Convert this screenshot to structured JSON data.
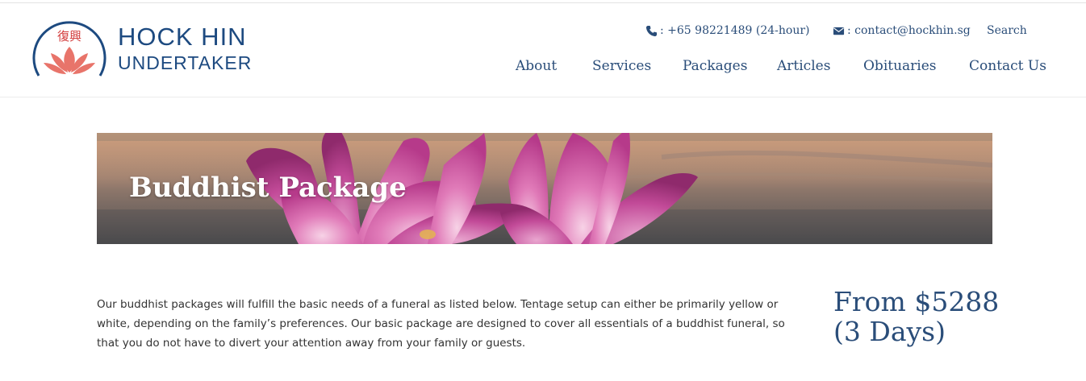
{
  "brand": {
    "chinese_mark": "復興",
    "name_line1": "HOCK HIN",
    "name_line2": "UNDERTAKER",
    "primary_color": "#1d4a80",
    "lotus_color": "#e8746a"
  },
  "contact_bar": {
    "phone_icon": "phone-icon",
    "phone": ": +65 98221489 (24-hour)",
    "email_icon": "envelope-icon",
    "email": ": contact@hockhin.sg",
    "search_label": "Search"
  },
  "nav": {
    "items": [
      "About",
      "Services",
      "Packages",
      "Articles",
      "Obituaries",
      "Contact Us"
    ]
  },
  "banner": {
    "title": "Buddhist Package",
    "image": "pink lotus flowers at dusk"
  },
  "content": {
    "intro": "Our buddhist packages will fulfill the basic needs of a funeral as listed below. Tentage setup can either be primarily yellow or white, depending on the family’s preferences. Our basic package are designed to cover all essentials of a buddhist funeral, so that you do not have to divert your attention away from your family or guests.",
    "price_line1": "From $5288",
    "price_line2": "(3 Days)"
  }
}
